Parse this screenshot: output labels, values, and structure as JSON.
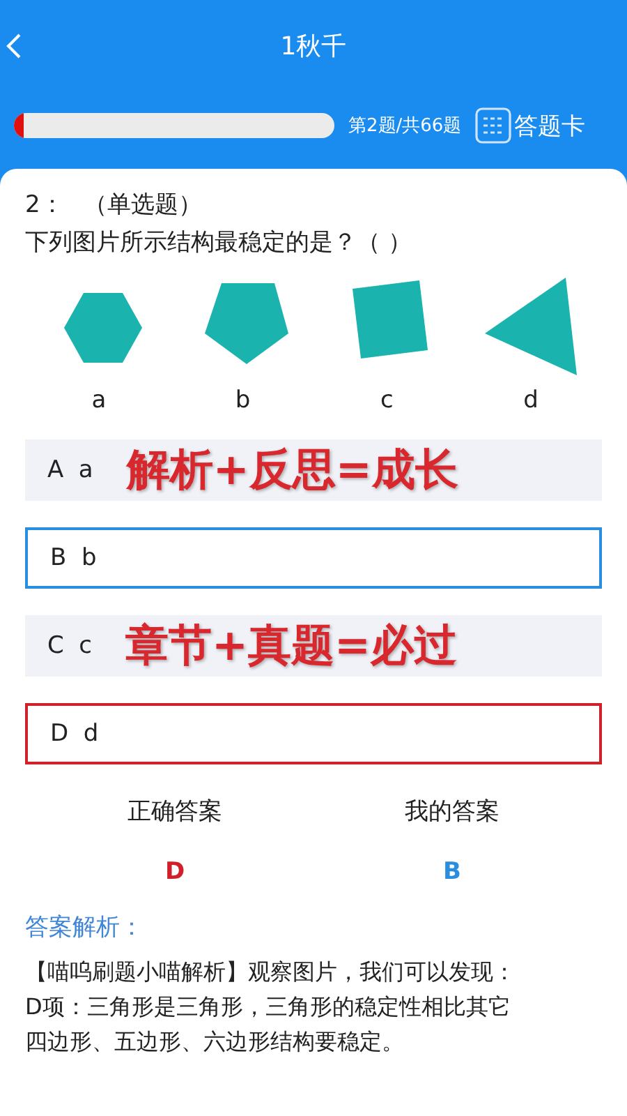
{
  "header": {
    "title": "1秋千"
  },
  "progress": {
    "level": 0.03,
    "counter": "第2题/共66题",
    "answer_card": "答题卡"
  },
  "question": {
    "number": "2：",
    "type": "（单选题）",
    "text": "下列图片所示结构最稳定的是？（ ）"
  },
  "figures": [
    {
      "kind": "hexagon",
      "label": "a"
    },
    {
      "kind": "pentagon",
      "label": "b"
    },
    {
      "kind": "square",
      "label": "c"
    },
    {
      "kind": "triangle",
      "label": "d"
    }
  ],
  "options": [
    {
      "letter": "A",
      "text": "a",
      "selected": false,
      "correct": false,
      "overlay": "解析+反思=成长"
    },
    {
      "letter": "B",
      "text": "b",
      "selected": true,
      "correct": false
    },
    {
      "letter": "C",
      "text": "c",
      "selected": false,
      "correct": false,
      "overlay": "章节+真题=必过"
    },
    {
      "letter": "D",
      "text": "d",
      "selected": false,
      "correct": true
    }
  ],
  "answers": {
    "correct_label": "正确答案",
    "correct": "D",
    "mine_label": "我的答案",
    "mine": "B"
  },
  "analysis": {
    "title": "答案解析：",
    "lead": "【喵呜刷题小喵解析】观察图片，我们可以发现：",
    "body": "D项：三角形是三角形，三角形的稳定性相比其它四边形、五边形、六边形结构要稳定。"
  }
}
